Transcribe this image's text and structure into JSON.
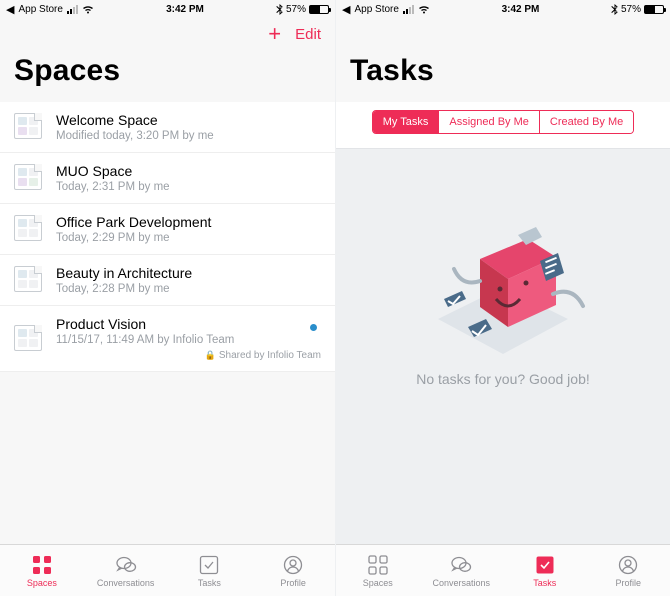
{
  "status": {
    "back": "App Store",
    "time": "3:42 PM",
    "bluetooth": "*",
    "battery_pct": "57%"
  },
  "left": {
    "title": "Spaces",
    "nav_edit": "Edit",
    "items": [
      {
        "title": "Welcome Space",
        "sub": "Modified today, 3:20 PM by me"
      },
      {
        "title": "MUO Space",
        "sub": "Today, 2:31 PM by me"
      },
      {
        "title": "Office Park Development",
        "sub": "Today, 2:29 PM by me"
      },
      {
        "title": "Beauty in Architecture",
        "sub": "Today, 2:28 PM by me"
      },
      {
        "title": "Product Vision",
        "sub": "11/15/17, 11:49 AM by Infolio Team",
        "shared": "Shared by Infolio Team",
        "unread": true
      }
    ],
    "tabs": [
      "Spaces",
      "Conversations",
      "Tasks",
      "Profile"
    ],
    "active_tab": 0
  },
  "right": {
    "title": "Tasks",
    "segments": [
      "My Tasks",
      "Assigned By Me",
      "Created By Me"
    ],
    "active_segment": 0,
    "empty_text": "No tasks for you? Good job!",
    "tabs": [
      "Spaces",
      "Conversations",
      "Tasks",
      "Profile"
    ],
    "active_tab": 2
  },
  "accent": "#ee2c57"
}
